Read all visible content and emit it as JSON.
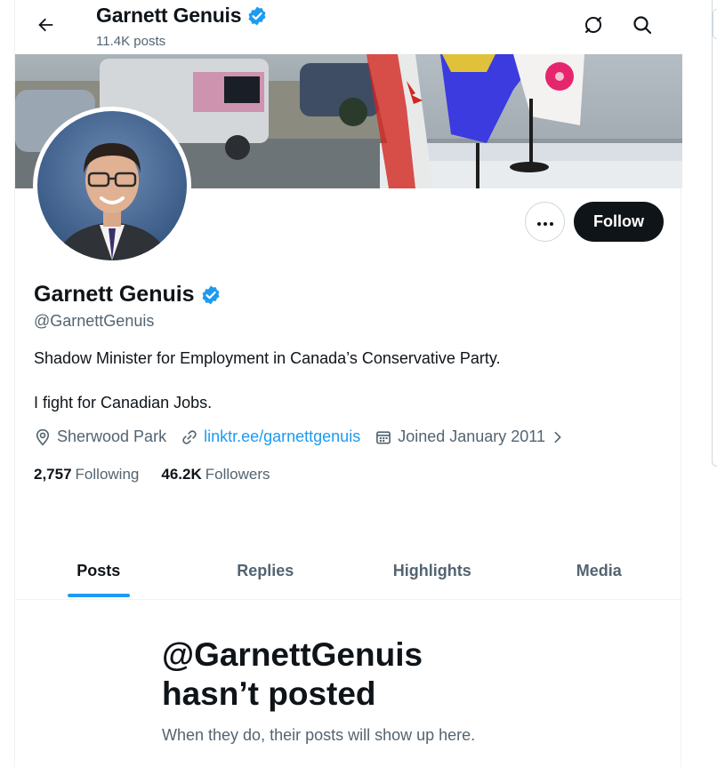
{
  "header": {
    "name": "Garnett Genuis",
    "post_count": "11.4K posts",
    "icons": [
      "back-arrow-icon",
      "grok-icon",
      "search-icon"
    ]
  },
  "profile": {
    "name": "Garnett Genuis",
    "handle": "@GarnettGenuis",
    "bio_line1": "Shadow Minister for Employment in Canada’s Conservative Party.",
    "bio_line2": "I fight for Canadian Jobs.",
    "location": "Sherwood Park",
    "link": "linktr.ee/garnettgenuis",
    "joined": "Joined January 2011",
    "following_count": "2,757",
    "following_label": "Following",
    "followers_count": "46.2K",
    "followers_label": "Followers",
    "verified_color": "#1d9bf0"
  },
  "actions": {
    "follow_label": "Follow"
  },
  "tabs": [
    {
      "label": "Posts",
      "active": true
    },
    {
      "label": "Replies",
      "active": false
    },
    {
      "label": "Highlights",
      "active": false
    },
    {
      "label": "Media",
      "active": false
    }
  ],
  "empty_state": {
    "title_line1": "@GarnettGenuis",
    "title_line2": "hasn’t posted",
    "subtitle": "When they do, their posts will show up here."
  },
  "colors": {
    "accent": "#1d9bf0",
    "text_primary": "#0f1419",
    "text_secondary": "#536471"
  }
}
